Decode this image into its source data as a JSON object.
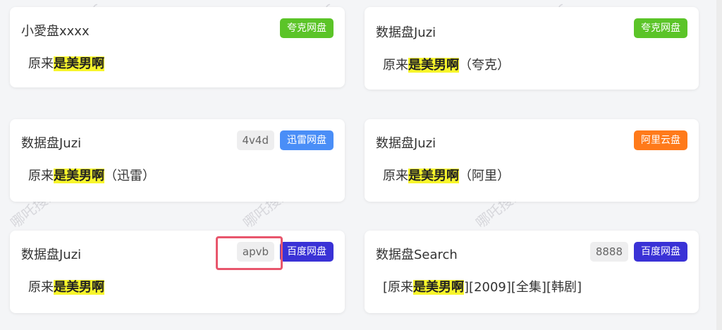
{
  "cards": [
    {
      "source": "小愛盘xxxx",
      "code": "",
      "badge": "夸克网盘",
      "badge_color": "#5bc428",
      "title_pre": "原来",
      "title_hl": "是美男啊",
      "title_post": ""
    },
    {
      "source": "数据盘Juzi",
      "code": "",
      "badge": "夸克网盘",
      "badge_color": "#5bc428",
      "title_pre": "原来",
      "title_hl": "是美男啊",
      "title_post": "（夸克）"
    },
    {
      "source": "数据盘Juzi",
      "code": "4v4d",
      "badge": "迅雷网盘",
      "badge_color": "#4a8ef7",
      "title_pre": "原来",
      "title_hl": "是美男啊",
      "title_post": "（迅雷）"
    },
    {
      "source": "数据盘Juzi",
      "code": "",
      "badge": "阿里云盘",
      "badge_color": "#ff7a1a",
      "title_pre": "原来",
      "title_hl": "是美男啊",
      "title_post": "（阿里）"
    },
    {
      "source": "数据盘Juzi",
      "code": "apvb",
      "badge": "百度网盘",
      "badge_color": "#3a32d6",
      "title_pre": "原来",
      "title_hl": "是美男啊",
      "title_post": ""
    },
    {
      "source": "数据盘Search",
      "code": "8888",
      "badge": "百度网盘",
      "badge_color": "#3a32d6",
      "title_pre": "[原来",
      "title_hl": "是美男啊",
      "title_post": "][2009][全集][韩剧]"
    }
  ],
  "watermark": "哪吒搜索Nzso.cc"
}
